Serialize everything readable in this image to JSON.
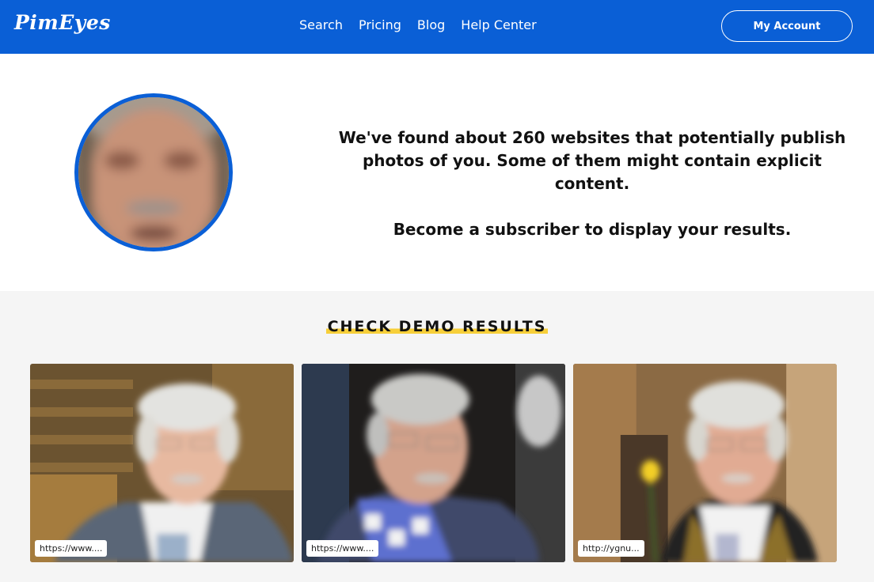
{
  "header": {
    "logo": "PimEyes",
    "nav": [
      "Search",
      "Pricing",
      "Blog",
      "Help Center"
    ],
    "account_button": "My Account",
    "brand_color": "#0a5fd6"
  },
  "hero": {
    "message_line": "We've found about 260 websites that potentially publish photos of you. Some of them might contain explicit content.",
    "cta_line": "Become a subscriber to display your results."
  },
  "demo": {
    "title": "CHECK DEMO RESULTS",
    "highlight_color": "#f7cf3a",
    "results": [
      {
        "url": "https://www...."
      },
      {
        "url": "https://www...."
      },
      {
        "url": "http://ygnu..."
      }
    ]
  }
}
